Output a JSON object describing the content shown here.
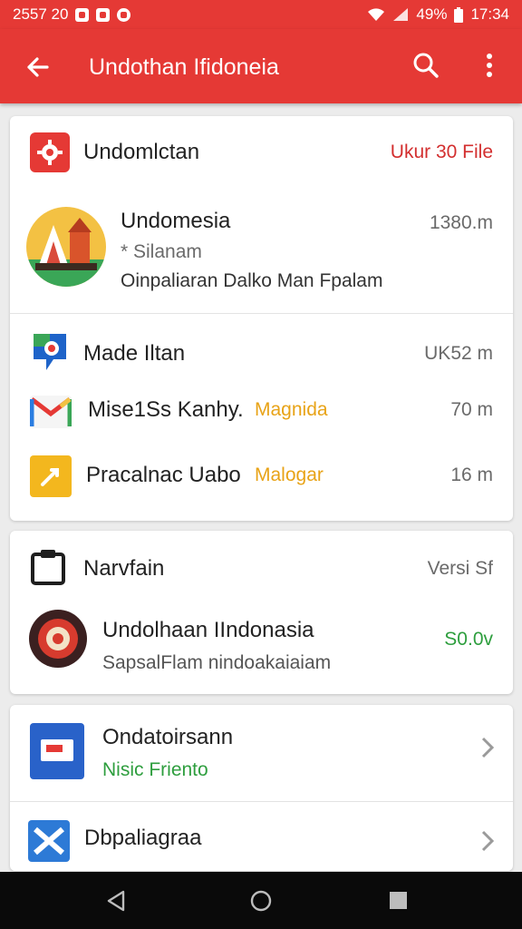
{
  "status_bar": {
    "time_left": "2557 20",
    "battery": "49%",
    "time_right": "17:34"
  },
  "app_bar": {
    "title": "Undothan Ifidoneia",
    "icons": [
      "arrow-back-icon",
      "search-icon",
      "more-vert-icon"
    ]
  },
  "card_main": {
    "header_title": "Undomlctan",
    "header_action": "Ukur 30 File",
    "featured": {
      "title": "Undomesia",
      "subtitle": "* Silanam",
      "description": "Oinpaliaran Dalko Man Fpalam",
      "meta": "1380.m"
    },
    "list_header": {
      "title": "Made Iltan",
      "meta": "UK52 m"
    },
    "items": [
      {
        "name": "Mise1Ss Kanhy.",
        "tag": "Magnida",
        "meta": "70 m",
        "icon": "gmail-icon"
      },
      {
        "name": "Pracalnac Uabo",
        "tag": "Malogar",
        "meta": "16 m",
        "icon": "slides-icon"
      }
    ]
  },
  "card_nav": {
    "header_title": "Narvfain",
    "header_meta": "Versi Sf",
    "item": {
      "title": "Undolhaan IIndonasia",
      "subtitle": "SapsalFlam nindoakaiaiam",
      "meta": "S0.0v"
    }
  },
  "card_links": {
    "items": [
      {
        "title": "Ondatoirsann",
        "subtitle": "Nisic Friento"
      },
      {
        "title": "Dbpaliagraa",
        "subtitle": ""
      }
    ]
  },
  "colors": {
    "brand_red": "#e53935",
    "accent_orange": "#e8a317",
    "accent_green": "#2e9e3e",
    "link_red": "#d32f2f"
  }
}
